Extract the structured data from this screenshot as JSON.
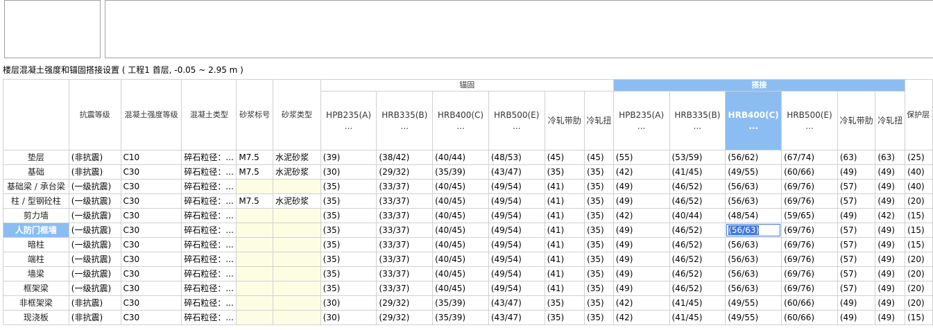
{
  "caption": "楼层混凝土强度和锚固搭接设置 ( 工程1  首层, -0.05 ~ 2.95 m )",
  "groups": {
    "anchor": "锚固",
    "lap": "搭接"
  },
  "headers": {
    "seismic": "抗震等级",
    "concrete_grade": "混凝土强度等级",
    "concrete_type": "混凝土类型",
    "mortar_grade": "砂浆标号",
    "mortar_type": "砂浆类型",
    "protect": "保护层"
  },
  "anchor_cols": [
    "HPB235(A)",
    "HRB335(B)",
    "HRB400(C)",
    "HRB500(E)",
    "冷轧带肋",
    "冷轧扭"
  ],
  "lap_cols": [
    "HPB235(A)",
    "HRB335(B)",
    "HRB400(C)",
    "HRB500(E)",
    "冷轧带肋",
    "冷轧扭"
  ],
  "ellipsis": "...",
  "active_lap_col": 2,
  "selected_row": 5,
  "colors": {
    "selection": "#8bbdf3",
    "mortar_bg": "#fdfde4"
  },
  "rows": [
    {
      "name": "垫层",
      "seismic": "(非抗震)",
      "grade": "C10",
      "ctype": "碎石粒径：...",
      "mgrade": "M7.5",
      "mtype": "水泥砂浆",
      "anchor": [
        "(39)",
        "(38/42)",
        "(40/44)",
        "(48/53)",
        "(45)",
        "(45)"
      ],
      "lap": [
        "(55)",
        "(53/59)",
        "(56/62)",
        "(67/74)",
        "(63)",
        "(63)"
      ],
      "protect": "(25)"
    },
    {
      "name": "基础",
      "seismic": "(非抗震)",
      "grade": "C30",
      "ctype": "碎石粒径：...",
      "mgrade": "M7.5",
      "mtype": "水泥砂浆",
      "anchor": [
        "(30)",
        "(29/32)",
        "(35/39)",
        "(43/47)",
        "(35)",
        "(35)"
      ],
      "lap": [
        "(42)",
        "(41/45)",
        "(49/55)",
        "(60/66)",
        "(49)",
        "(49)"
      ],
      "protect": "(40)"
    },
    {
      "name": "基础梁 / 承台梁",
      "seismic": "(一级抗震)",
      "grade": "C30",
      "ctype": "碎石粒径：...",
      "mgrade": "",
      "mtype": "",
      "anchor": [
        "(35)",
        "(33/37)",
        "(40/45)",
        "(49/54)",
        "(41)",
        "(35)"
      ],
      "lap": [
        "(49)",
        "(46/52)",
        "(56/63)",
        "(69/76)",
        "(57)",
        "(49)"
      ],
      "protect": "(40)"
    },
    {
      "name": "柱 / 型钢砼柱",
      "seismic": "(一级抗震)",
      "grade": "C30",
      "ctype": "碎石粒径：...",
      "mgrade": "M7.5",
      "mtype": "水泥砂浆",
      "anchor": [
        "(35)",
        "(33/37)",
        "(40/45)",
        "(49/54)",
        "(41)",
        "(35)"
      ],
      "lap": [
        "(49)",
        "(46/52)",
        "(56/63)",
        "(69/76)",
        "(57)",
        "(49)"
      ],
      "protect": "(20)"
    },
    {
      "name": "剪力墙",
      "seismic": "(一级抗震)",
      "grade": "C30",
      "ctype": "碎石粒径：...",
      "mgrade": "",
      "mtype": "",
      "anchor": [
        "(35)",
        "(33/37)",
        "(40/45)",
        "(49/54)",
        "(41)",
        "(35)"
      ],
      "lap": [
        "(42)",
        "(40/44)",
        "(48/54)",
        "(59/65)",
        "(49)",
        "(42)"
      ],
      "protect": "(15)"
    },
    {
      "name": "人防门框墙",
      "seismic": "(一级抗震)",
      "grade": "C30",
      "ctype": "碎石粒径：...",
      "mgrade": "",
      "mtype": "",
      "anchor": [
        "(35)",
        "(33/37)",
        "(40/45)",
        "(49/54)",
        "(41)",
        "(35)"
      ],
      "lap": [
        "(49)",
        "(46/52)",
        "(56/63)",
        "(69/76)",
        "(57)",
        "(49)"
      ],
      "protect": "(15)"
    },
    {
      "name": "暗柱",
      "seismic": "(一级抗震)",
      "grade": "C30",
      "ctype": "碎石粒径：...",
      "mgrade": "",
      "mtype": "",
      "anchor": [
        "(35)",
        "(33/37)",
        "(40/45)",
        "(49/54)",
        "(41)",
        "(35)"
      ],
      "lap": [
        "(49)",
        "(46/52)",
        "(56/63)",
        "(69/76)",
        "(57)",
        "(49)"
      ],
      "protect": "(15)"
    },
    {
      "name": "端柱",
      "seismic": "(一级抗震)",
      "grade": "C30",
      "ctype": "碎石粒径：...",
      "mgrade": "",
      "mtype": "",
      "anchor": [
        "(35)",
        "(33/37)",
        "(40/45)",
        "(49/54)",
        "(41)",
        "(35)"
      ],
      "lap": [
        "(49)",
        "(46/52)",
        "(56/63)",
        "(69/76)",
        "(57)",
        "(49)"
      ],
      "protect": "(20)"
    },
    {
      "name": "墙梁",
      "seismic": "(一级抗震)",
      "grade": "C30",
      "ctype": "碎石粒径：...",
      "mgrade": "",
      "mtype": "",
      "anchor": [
        "(35)",
        "(33/37)",
        "(40/45)",
        "(49/54)",
        "(41)",
        "(35)"
      ],
      "lap": [
        "(49)",
        "(46/52)",
        "(56/63)",
        "(69/76)",
        "(57)",
        "(49)"
      ],
      "protect": "(20)"
    },
    {
      "name": "框架梁",
      "seismic": "(一级抗震)",
      "grade": "C30",
      "ctype": "碎石粒径：...",
      "mgrade": "",
      "mtype": "",
      "anchor": [
        "(35)",
        "(33/37)",
        "(40/45)",
        "(49/54)",
        "(41)",
        "(35)"
      ],
      "lap": [
        "(49)",
        "(46/52)",
        "(56/63)",
        "(69/76)",
        "(57)",
        "(49)"
      ],
      "protect": "(20)"
    },
    {
      "name": "非框架梁",
      "seismic": "(非抗震)",
      "grade": "C30",
      "ctype": "碎石粒径：...",
      "mgrade": "",
      "mtype": "",
      "anchor": [
        "(30)",
        "(29/32)",
        "(35/39)",
        "(43/47)",
        "(35)",
        "(35)"
      ],
      "lap": [
        "(42)",
        "(41/45)",
        "(49/55)",
        "(60/66)",
        "(49)",
        "(49)"
      ],
      "protect": "(20)"
    },
    {
      "name": "现浇板",
      "seismic": "(非抗震)",
      "grade": "C30",
      "ctype": "碎石粒径：...",
      "mgrade": "",
      "mtype": "",
      "anchor": [
        "(30)",
        "(29/32)",
        "(35/39)",
        "(43/47)",
        "(35)",
        "(35)"
      ],
      "lap": [
        "(42)",
        "(41/45)",
        "(49/55)",
        "(60/66)",
        "(49)",
        "(49)"
      ],
      "protect": "(15)"
    }
  ]
}
